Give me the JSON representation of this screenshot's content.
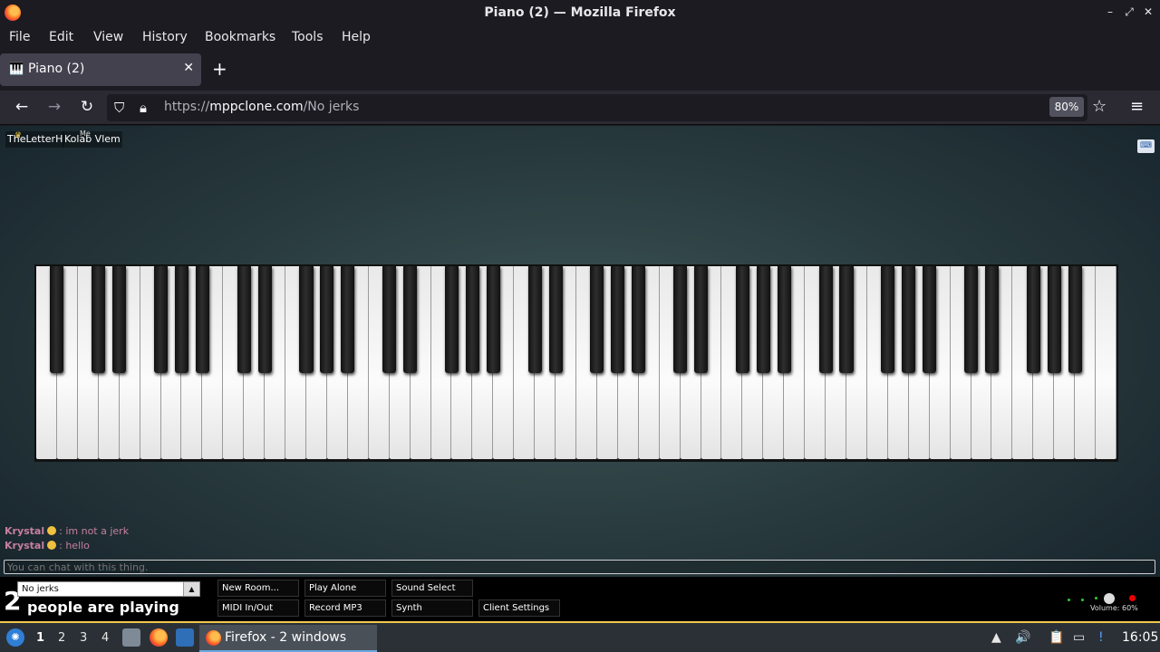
{
  "window": {
    "title": "Piano (2) — Mozilla Firefox",
    "controls": [
      "–",
      "⤢",
      "✕"
    ]
  },
  "menubar": {
    "items": [
      "File",
      "Edit",
      "View",
      "History",
      "Bookmarks",
      "Tools",
      "Help"
    ]
  },
  "tabs": [
    {
      "label": "Piano (2)",
      "icon": "piano-icon",
      "close": "✕"
    }
  ],
  "newtab_glyph": "+",
  "navbar": {
    "back": "←",
    "forward": "→",
    "reload": "↻",
    "url_scheme": "https://",
    "url_host": "mppclone.com",
    "url_path": "/No jerks",
    "zoom": "80%",
    "bookmark_star": "☆",
    "menu": "≡"
  },
  "page": {
    "users": [
      {
        "name": "TheLetterH",
        "crown": "♛"
      },
      {
        "name": "Kolab Vlem",
        "me": "Me"
      }
    ],
    "corner_button": "⌨",
    "piano": {
      "white_keys": 52,
      "black_keys": 36
    },
    "chat": [
      {
        "name": "Krystal",
        "message": "im not a jerk"
      },
      {
        "name": "Krystal",
        "message": "hello"
      }
    ],
    "chat_placeholder": "You can chat with this thing.",
    "room": "No jerks",
    "room_arrow": "▲",
    "people_count": "2",
    "people_label": "people are playing",
    "buttons": {
      "new_room": "New Room...",
      "play_alone": "Play Alone",
      "sound_select": "Sound Select",
      "midi": "MIDI In/Out",
      "record": "Record MP3",
      "synth": "Synth",
      "client_settings": "Client Settings"
    },
    "volume_label": "Volume: 60%",
    "volume": 0.6
  },
  "taskbar": {
    "workspaces": [
      "1",
      "2",
      "3",
      "4"
    ],
    "active_workspace": "1",
    "task_label": "Firefox - 2 windows",
    "clock": "16:05",
    "tray_icons": [
      "▲",
      "🔊",
      "📋",
      "▭",
      "!"
    ]
  },
  "colors": {
    "chat_name": "#c77fa0",
    "panel_accent": "#f2c94c"
  }
}
